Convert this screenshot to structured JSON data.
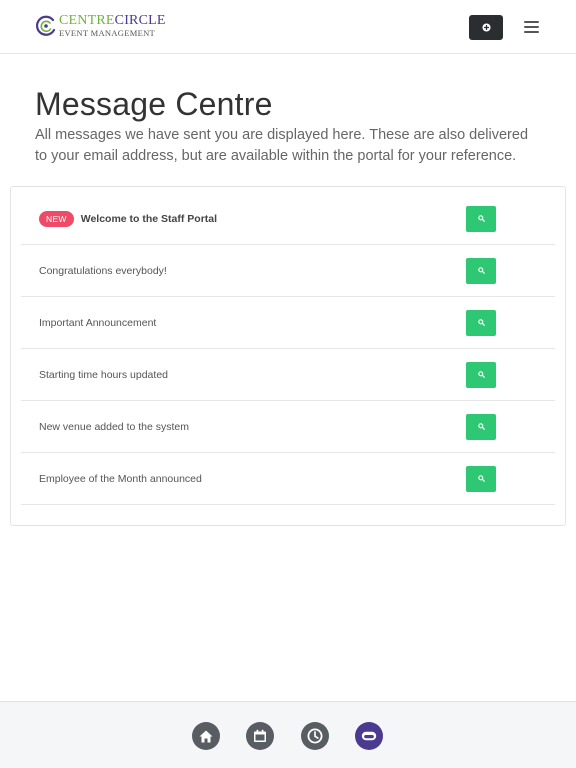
{
  "header": {
    "logo": {
      "line1_part1": "CENTRE",
      "line1_part2": "CIRCLE",
      "line2": "EVENT MANAGEMENT"
    },
    "action_icon": "plus-circle-icon",
    "menu_icon": "hamburger-icon"
  },
  "main": {
    "title": "Message Centre",
    "description": "All messages we have sent you are displayed here. These are also delivered to your email address, but are available within the portal for your reference."
  },
  "messages": [
    {
      "title": "Welcome to the Staff Portal",
      "badge": "NEW",
      "unread": true
    },
    {
      "title": "Congratulations everybody!",
      "unread": false
    },
    {
      "title": "Important Announcement",
      "unread": false
    },
    {
      "title": "Starting time hours updated",
      "unread": false
    },
    {
      "title": "New venue added to the system",
      "unread": false
    },
    {
      "title": "Employee of the Month announced",
      "unread": false
    }
  ],
  "view_button_icon": "search-icon",
  "bottom_nav": [
    {
      "icon": "home-icon",
      "active": false
    },
    {
      "icon": "calendar-icon",
      "active": false
    },
    {
      "icon": "clock-icon",
      "active": false
    },
    {
      "icon": "messages-icon",
      "active": true
    }
  ],
  "colors": {
    "brand_purple": "#4b3a8f",
    "brand_green": "#6fb33d",
    "view_button": "#2ec774",
    "badge_new": "#ee4b68",
    "dark_button": "#2b2d30",
    "nav_icon_bg": "#585d63"
  }
}
